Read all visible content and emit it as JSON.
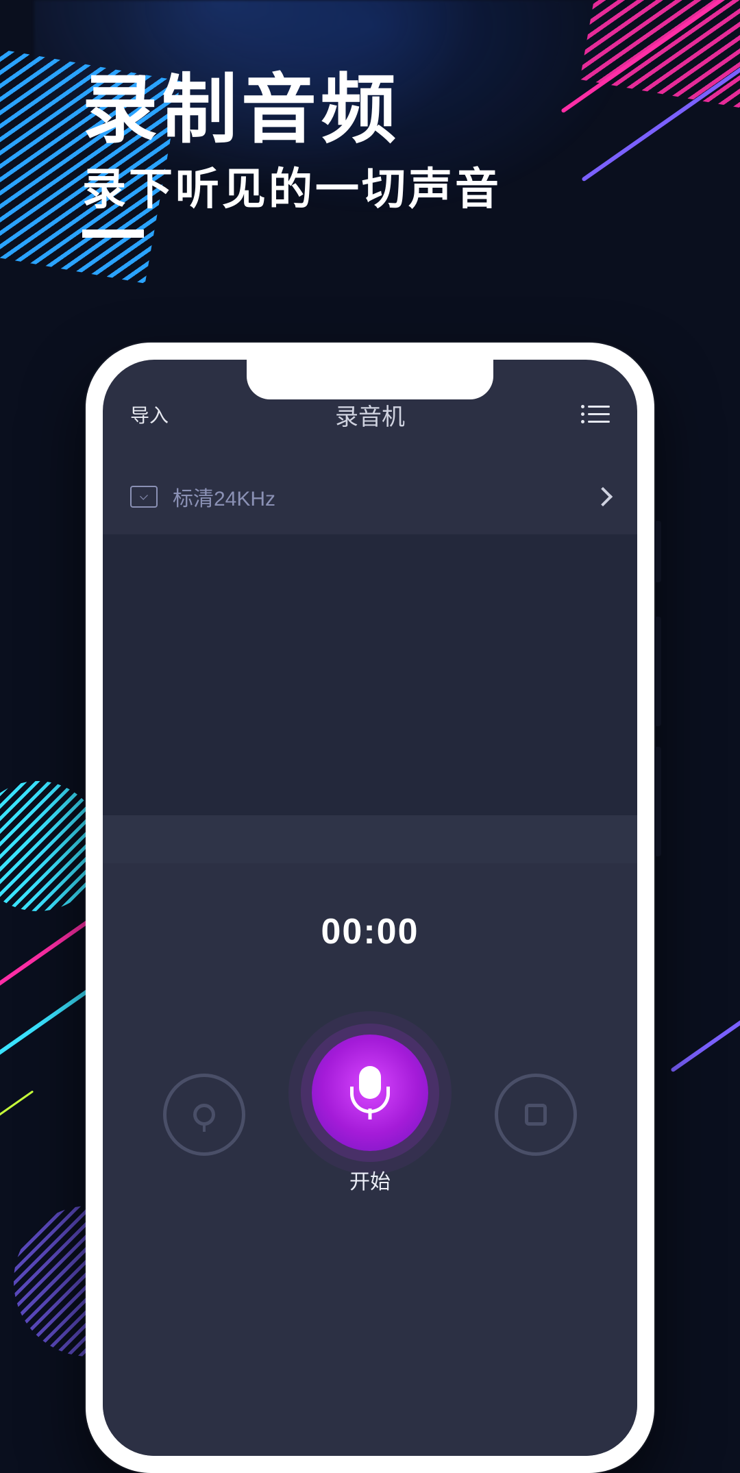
{
  "promo": {
    "title": "录制音频",
    "subtitle": "录下听见的一切声音"
  },
  "app": {
    "header": {
      "import_label": "导入",
      "title": "录音机"
    },
    "quality": {
      "label": "标清24KHz"
    },
    "timer": "00:00",
    "record_label": "开始"
  },
  "colors": {
    "accent_magenta": "#d847ff",
    "accent_cyan": "#3be3ff"
  }
}
